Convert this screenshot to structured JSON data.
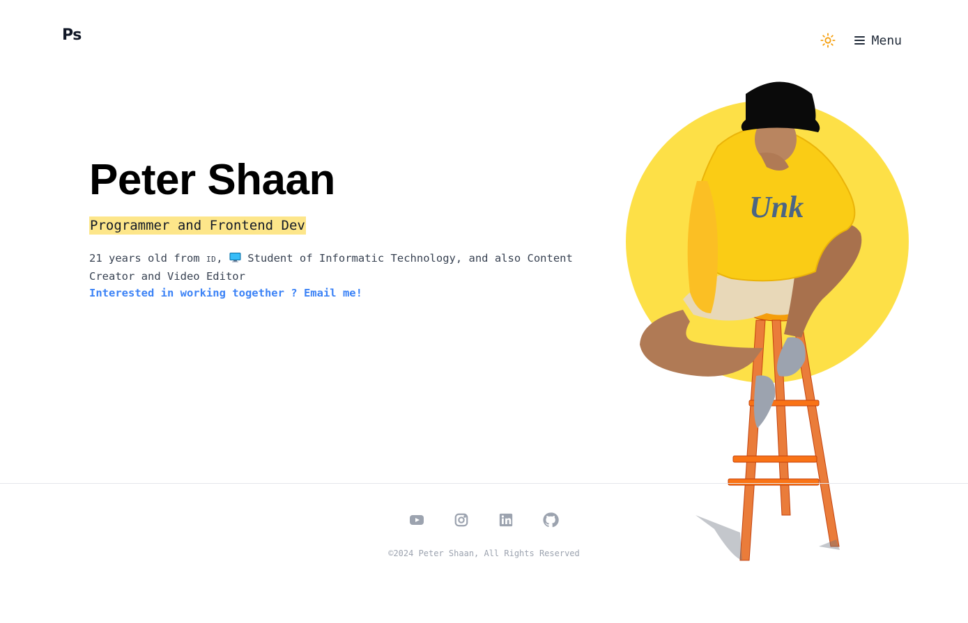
{
  "header": {
    "logo": "Ps",
    "theme_icon": "sun-icon",
    "menu_icon": "hamburger-icon",
    "menu_label": "Menu"
  },
  "hero": {
    "name": "Peter Shaan",
    "role": "Programmer and Frontend Dev",
    "desc_part1": "21 years old from ",
    "country_flag": "ID",
    "desc_part2": ", ",
    "pc_icon": "desktop-computer-icon",
    "desc_part3": " Student of Informatic Technology, and also Content Creator and Video Editor",
    "cta": "Interested in working together ? Email me!"
  },
  "portrait": {
    "alt": "person-sitting-on-stool-illustration"
  },
  "footer": {
    "socials": [
      {
        "name": "youtube-icon"
      },
      {
        "name": "instagram-icon"
      },
      {
        "name": "linkedin-icon"
      },
      {
        "name": "github-icon"
      }
    ],
    "copyright": "©2024 Peter Shaan, All Rights Reserved"
  },
  "colors": {
    "accent_yellow": "#fde047",
    "highlight": "#fde68a",
    "link_blue": "#3b82f6",
    "sun": "#f59e0b",
    "social_gray": "#9ca3af"
  }
}
